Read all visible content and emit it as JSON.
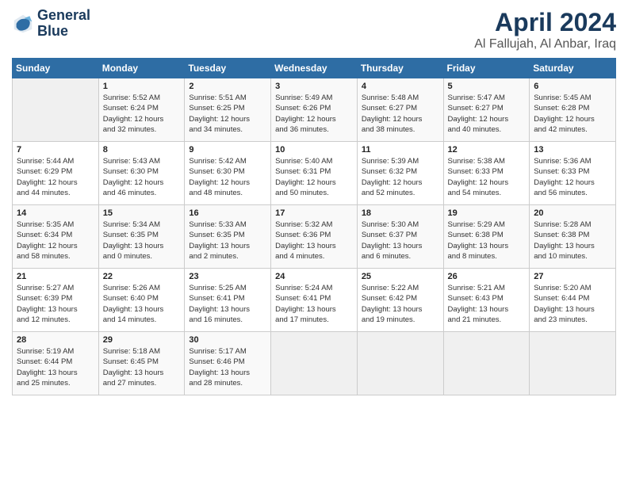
{
  "header": {
    "logo_line1": "General",
    "logo_line2": "Blue",
    "month": "April 2024",
    "location": "Al Fallujah, Al Anbar, Iraq"
  },
  "weekdays": [
    "Sunday",
    "Monday",
    "Tuesday",
    "Wednesday",
    "Thursday",
    "Friday",
    "Saturday"
  ],
  "weeks": [
    [
      {
        "day": "",
        "info": ""
      },
      {
        "day": "1",
        "info": "Sunrise: 5:52 AM\nSunset: 6:24 PM\nDaylight: 12 hours\nand 32 minutes."
      },
      {
        "day": "2",
        "info": "Sunrise: 5:51 AM\nSunset: 6:25 PM\nDaylight: 12 hours\nand 34 minutes."
      },
      {
        "day": "3",
        "info": "Sunrise: 5:49 AM\nSunset: 6:26 PM\nDaylight: 12 hours\nand 36 minutes."
      },
      {
        "day": "4",
        "info": "Sunrise: 5:48 AM\nSunset: 6:27 PM\nDaylight: 12 hours\nand 38 minutes."
      },
      {
        "day": "5",
        "info": "Sunrise: 5:47 AM\nSunset: 6:27 PM\nDaylight: 12 hours\nand 40 minutes."
      },
      {
        "day": "6",
        "info": "Sunrise: 5:45 AM\nSunset: 6:28 PM\nDaylight: 12 hours\nand 42 minutes."
      }
    ],
    [
      {
        "day": "7",
        "info": "Sunrise: 5:44 AM\nSunset: 6:29 PM\nDaylight: 12 hours\nand 44 minutes."
      },
      {
        "day": "8",
        "info": "Sunrise: 5:43 AM\nSunset: 6:30 PM\nDaylight: 12 hours\nand 46 minutes."
      },
      {
        "day": "9",
        "info": "Sunrise: 5:42 AM\nSunset: 6:30 PM\nDaylight: 12 hours\nand 48 minutes."
      },
      {
        "day": "10",
        "info": "Sunrise: 5:40 AM\nSunset: 6:31 PM\nDaylight: 12 hours\nand 50 minutes."
      },
      {
        "day": "11",
        "info": "Sunrise: 5:39 AM\nSunset: 6:32 PM\nDaylight: 12 hours\nand 52 minutes."
      },
      {
        "day": "12",
        "info": "Sunrise: 5:38 AM\nSunset: 6:33 PM\nDaylight: 12 hours\nand 54 minutes."
      },
      {
        "day": "13",
        "info": "Sunrise: 5:36 AM\nSunset: 6:33 PM\nDaylight: 12 hours\nand 56 minutes."
      }
    ],
    [
      {
        "day": "14",
        "info": "Sunrise: 5:35 AM\nSunset: 6:34 PM\nDaylight: 12 hours\nand 58 minutes."
      },
      {
        "day": "15",
        "info": "Sunrise: 5:34 AM\nSunset: 6:35 PM\nDaylight: 13 hours\nand 0 minutes."
      },
      {
        "day": "16",
        "info": "Sunrise: 5:33 AM\nSunset: 6:35 PM\nDaylight: 13 hours\nand 2 minutes."
      },
      {
        "day": "17",
        "info": "Sunrise: 5:32 AM\nSunset: 6:36 PM\nDaylight: 13 hours\nand 4 minutes."
      },
      {
        "day": "18",
        "info": "Sunrise: 5:30 AM\nSunset: 6:37 PM\nDaylight: 13 hours\nand 6 minutes."
      },
      {
        "day": "19",
        "info": "Sunrise: 5:29 AM\nSunset: 6:38 PM\nDaylight: 13 hours\nand 8 minutes."
      },
      {
        "day": "20",
        "info": "Sunrise: 5:28 AM\nSunset: 6:38 PM\nDaylight: 13 hours\nand 10 minutes."
      }
    ],
    [
      {
        "day": "21",
        "info": "Sunrise: 5:27 AM\nSunset: 6:39 PM\nDaylight: 13 hours\nand 12 minutes."
      },
      {
        "day": "22",
        "info": "Sunrise: 5:26 AM\nSunset: 6:40 PM\nDaylight: 13 hours\nand 14 minutes."
      },
      {
        "day": "23",
        "info": "Sunrise: 5:25 AM\nSunset: 6:41 PM\nDaylight: 13 hours\nand 16 minutes."
      },
      {
        "day": "24",
        "info": "Sunrise: 5:24 AM\nSunset: 6:41 PM\nDaylight: 13 hours\nand 17 minutes."
      },
      {
        "day": "25",
        "info": "Sunrise: 5:22 AM\nSunset: 6:42 PM\nDaylight: 13 hours\nand 19 minutes."
      },
      {
        "day": "26",
        "info": "Sunrise: 5:21 AM\nSunset: 6:43 PM\nDaylight: 13 hours\nand 21 minutes."
      },
      {
        "day": "27",
        "info": "Sunrise: 5:20 AM\nSunset: 6:44 PM\nDaylight: 13 hours\nand 23 minutes."
      }
    ],
    [
      {
        "day": "28",
        "info": "Sunrise: 5:19 AM\nSunset: 6:44 PM\nDaylight: 13 hours\nand 25 minutes."
      },
      {
        "day": "29",
        "info": "Sunrise: 5:18 AM\nSunset: 6:45 PM\nDaylight: 13 hours\nand 27 minutes."
      },
      {
        "day": "30",
        "info": "Sunrise: 5:17 AM\nSunset: 6:46 PM\nDaylight: 13 hours\nand 28 minutes."
      },
      {
        "day": "",
        "info": ""
      },
      {
        "day": "",
        "info": ""
      },
      {
        "day": "",
        "info": ""
      },
      {
        "day": "",
        "info": ""
      }
    ]
  ]
}
